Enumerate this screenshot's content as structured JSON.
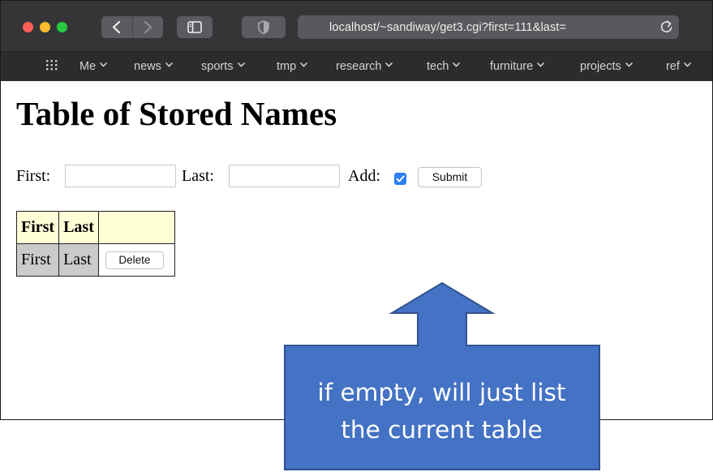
{
  "browser": {
    "url": "localhost/~sandiway/get3.cgi?first=111&last=",
    "bookmarks": [
      "Me",
      "news",
      "sports",
      "tmp",
      "research",
      "tech",
      "furniture",
      "projects",
      "ref"
    ]
  },
  "page": {
    "title": "Table of Stored Names",
    "form": {
      "first_label": "First:",
      "first_value": "",
      "last_label": "Last:",
      "last_value": "",
      "add_label": "Add:",
      "add_checked": true,
      "submit_label": "Submit"
    },
    "table": {
      "headers": [
        "First",
        "Last",
        ""
      ],
      "rows": [
        {
          "first": "First",
          "last": "Last",
          "action_label": "Delete"
        }
      ]
    }
  },
  "callout": {
    "line1": "if empty, will just list",
    "line2": "the current table"
  },
  "colors": {
    "callout_fill": "#4472c4",
    "callout_border": "#2f528f",
    "table_header_bg": "#fffed7",
    "table_row_bg": "#cbcbcb",
    "checkbox_blue": "#2b7ef5"
  }
}
